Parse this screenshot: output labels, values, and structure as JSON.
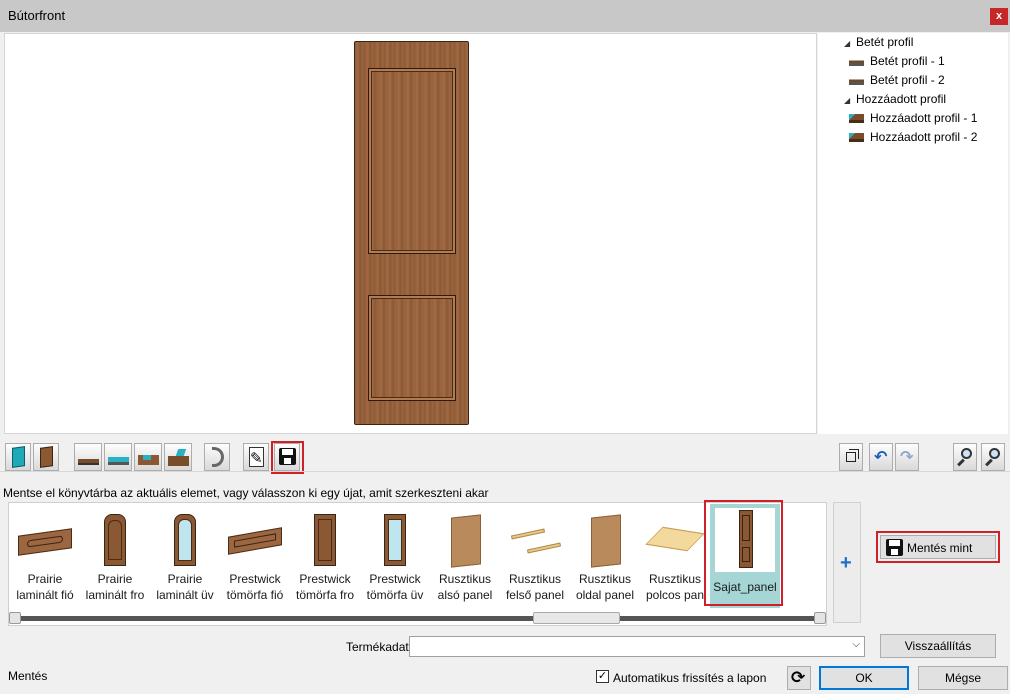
{
  "window": {
    "title": "Bútorfront",
    "close_label": "x"
  },
  "tree": {
    "groups": [
      {
        "label": "Betét profil",
        "children": [
          "Betét profil - 1",
          "Betét profil - 2"
        ]
      },
      {
        "label": "Hozzáadott profil",
        "children": [
          "Hozzáadott profil - 1",
          "Hozzáadott profil - 2"
        ]
      }
    ]
  },
  "toolbar": {
    "icons": [
      "front-panel-icon",
      "front-panel-wood-icon",
      "profile-flat-icon",
      "profile-glass-icon",
      "profile-groove-icon",
      "profile-added-icon",
      "rotate-icon",
      "edit-icon",
      "save-icon",
      "cube-view-icon",
      "undo-icon",
      "redo-icon",
      "zoom-in-icon",
      "zoom-out-icon"
    ],
    "active": "save-icon"
  },
  "library": {
    "hint": "Mentse el könyvtárba az aktuális elemet, vagy válasszon ki egy újat, amit szerkeszteni akar",
    "items": [
      {
        "line1": "Prairie",
        "line2": "laminált fió"
      },
      {
        "line1": "Prairie",
        "line2": "laminált fro"
      },
      {
        "line1": "Prairie",
        "line2": "laminált üv"
      },
      {
        "line1": "Prestwick",
        "line2": "tömörfa fió"
      },
      {
        "line1": "Prestwick",
        "line2": "tömörfa fro"
      },
      {
        "line1": "Prestwick",
        "line2": "tömörfa üv"
      },
      {
        "line1": "Rusztikus",
        "line2": "alsó panel"
      },
      {
        "line1": "Rusztikus",
        "line2": "felső panel"
      },
      {
        "line1": "Rusztikus",
        "line2": "oldal panel"
      },
      {
        "line1": "Rusztikus",
        "line2": "polcos pan"
      },
      {
        "line1": "Sajat_panel",
        "line2": ""
      }
    ],
    "selected_index": 10,
    "add_label": "+",
    "save_as_label": "Mentés mint"
  },
  "form": {
    "product_label": "Termékadat",
    "product_value": "",
    "reset_label": "Visszaállítás",
    "auto_refresh_label": "Automatikus frissítés a lapon",
    "auto_refresh_checked": "✓",
    "ok_label": "OK",
    "cancel_label": "Mégse"
  },
  "status": {
    "text": "Mentés"
  },
  "colors": {
    "accent_red": "#d0202a",
    "selection": "#a5d5d5",
    "wood": "#9b6640"
  }
}
